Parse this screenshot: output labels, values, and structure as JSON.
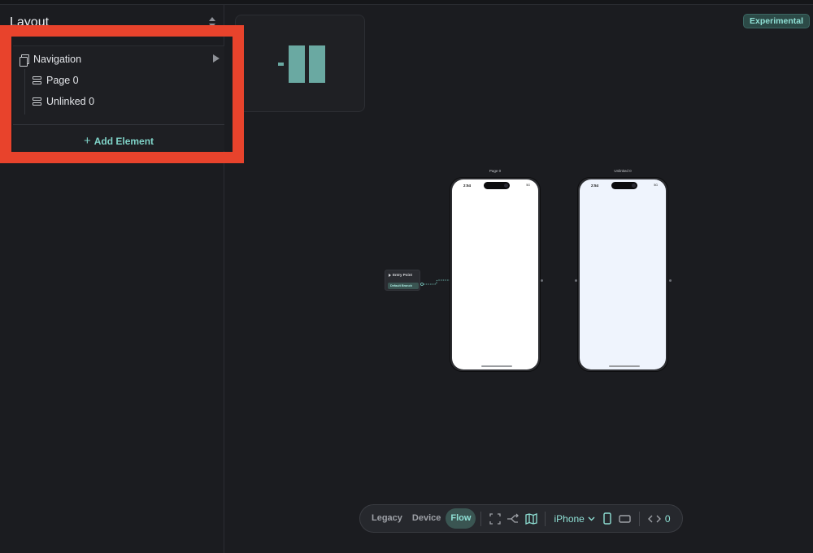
{
  "sidebar": {
    "title": "Layout",
    "tree": {
      "root_label": "Navigation",
      "children": [
        {
          "label": "Page 0"
        },
        {
          "label": "Unlinked 0"
        }
      ]
    },
    "add_element_label": "Add Element"
  },
  "canvas": {
    "badge": "Experimental",
    "phones": [
      {
        "label": "Page 0",
        "time": "2:54",
        "status": "5G"
      },
      {
        "label": "Unlinked 0",
        "time": "2:54",
        "status": "5G"
      }
    ],
    "entry_node": {
      "title": "Entry Point",
      "branch": "Default Branch"
    }
  },
  "toolbar": {
    "modes": [
      "Legacy",
      "Device",
      "Flow"
    ],
    "active_mode": "Flow",
    "device": "iPhone",
    "code_count": "0"
  },
  "colors": {
    "accent": "#8fe0d5",
    "highlight": "#e8432c",
    "background": "#1b1c20"
  }
}
